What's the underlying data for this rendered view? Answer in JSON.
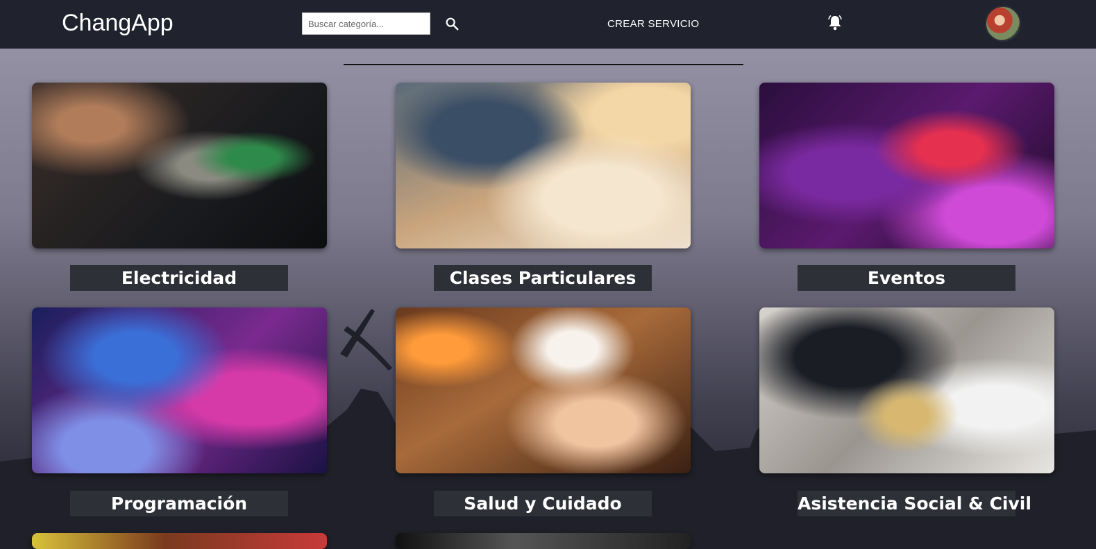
{
  "header": {
    "app_name": "ChangApp",
    "search_placeholder": "Buscar categoría...",
    "search_icon": "search-icon",
    "create_service_label": "CREAR SERVICIO",
    "notification_icon": "bell-icon",
    "avatar_icon": "user-avatar"
  },
  "categories": [
    {
      "label": "Electricidad",
      "image": "electricity-photo"
    },
    {
      "label": "Clases Particulares",
      "image": "tutoring-photo"
    },
    {
      "label": "Eventos",
      "image": "dj-equipment-photo"
    },
    {
      "label": "Programación",
      "image": "programming-photo"
    },
    {
      "label": "Salud y Cuidado",
      "image": "massage-photo"
    },
    {
      "label": "Asistencia Social & Civil",
      "image": "legal-scales-photo"
    },
    {
      "label": "",
      "image": "partially-visible-photo"
    },
    {
      "label": "",
      "image": "partially-visible-photo"
    }
  ]
}
